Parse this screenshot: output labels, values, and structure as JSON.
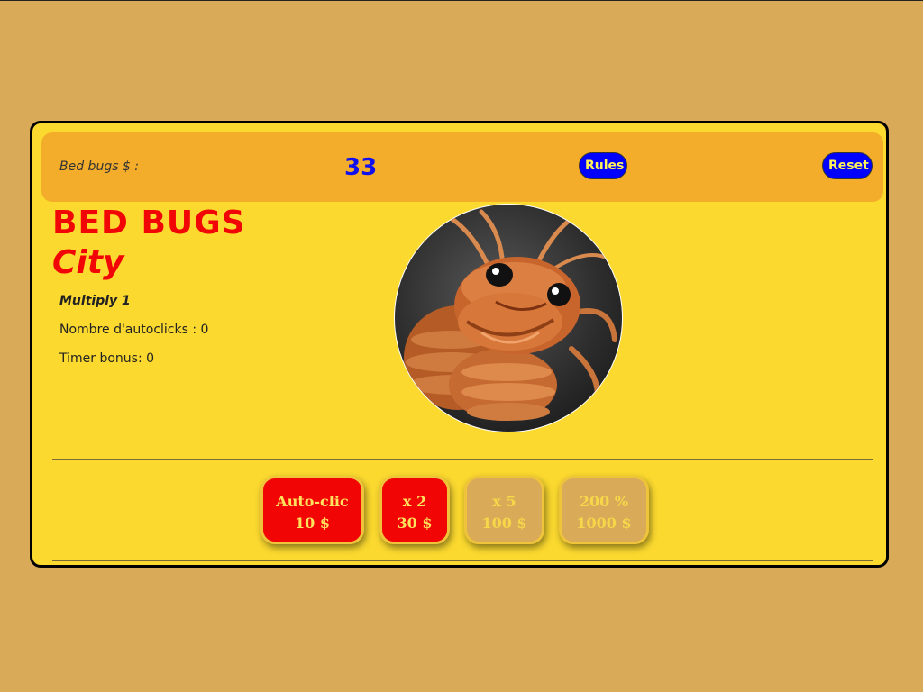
{
  "header": {
    "label": "Bed bugs $ :",
    "score": "33",
    "rules_label": "Rules",
    "reset_label": "Reset"
  },
  "title": {
    "line1": "BED BUGS",
    "line2": "City"
  },
  "stats": {
    "multiply": "Multiply 1",
    "autoclicks": "Nombre d'autoclicks : 0",
    "timer": "Timer bonus: 0"
  },
  "shop": [
    {
      "name": "Auto-clic",
      "price": "10 $",
      "available": true
    },
    {
      "name": "x 2",
      "price": "30 $",
      "available": true
    },
    {
      "name": "x 5",
      "price": "100 $",
      "available": false
    },
    {
      "name": "200 %",
      "price": "1000 $",
      "available": false
    }
  ],
  "colors": {
    "page_bg": "#d9aa57",
    "card_bg": "#fbd92f",
    "header_bg": "#f3ad2a",
    "accent_red": "#f20505",
    "accent_blue": "#0000ff",
    "score_blue": "#1010ee"
  },
  "icons": {
    "bug": "bed-bug-character-icon"
  }
}
